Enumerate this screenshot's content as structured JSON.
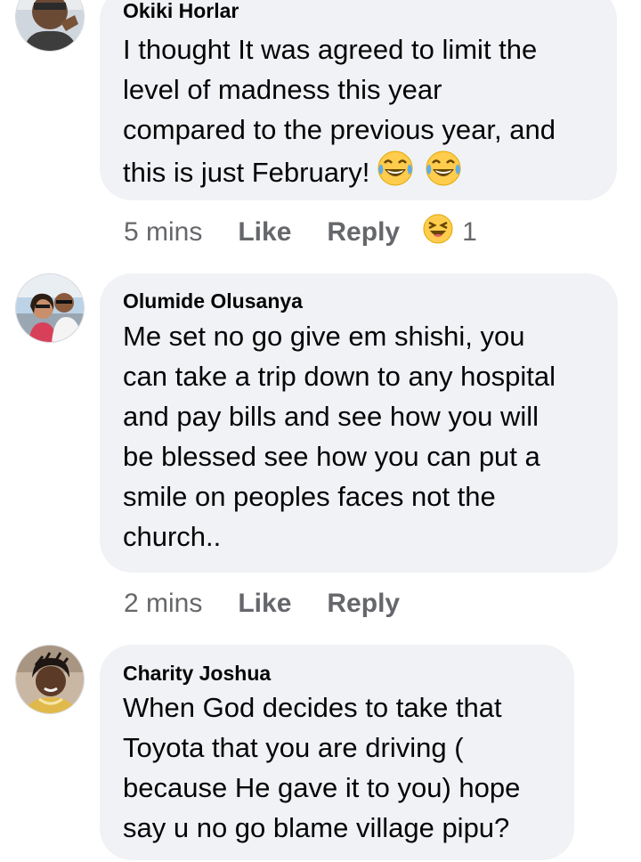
{
  "comments": [
    {
      "author": "Okiki Horlar",
      "lines": [
        "I thought It was agreed to limit the",
        "level of madness this year",
        "compared to the previous year, and",
        "this is just February!"
      ],
      "emojis": [
        "tears-of-joy",
        "tears-of-joy"
      ],
      "time": "5 mins",
      "like_label": "Like",
      "reply_label": "Reply",
      "reaction": {
        "icon": "laughing-squint-face",
        "count": "1"
      }
    },
    {
      "author": "Olumide Olusanya",
      "lines": [
        "Me set no go give em shishi, you",
        "can take a trip down to any hospital",
        "and pay bills and see how you will",
        "be blessed see how you can put a",
        "smile on peoples faces not the",
        "church.."
      ],
      "time": "2 mins",
      "like_label": "Like",
      "reply_label": "Reply"
    },
    {
      "author": "Charity Joshua",
      "lines": [
        "When God decides to take that",
        "Toyota that you are driving (",
        "because He gave it to you) hope",
        "say u no go blame village pipu?"
      ]
    }
  ],
  "colors": {
    "bubble": "#f0f2f5",
    "meta_text": "#65676b",
    "emoji_yellow": "#ffcc4d"
  }
}
